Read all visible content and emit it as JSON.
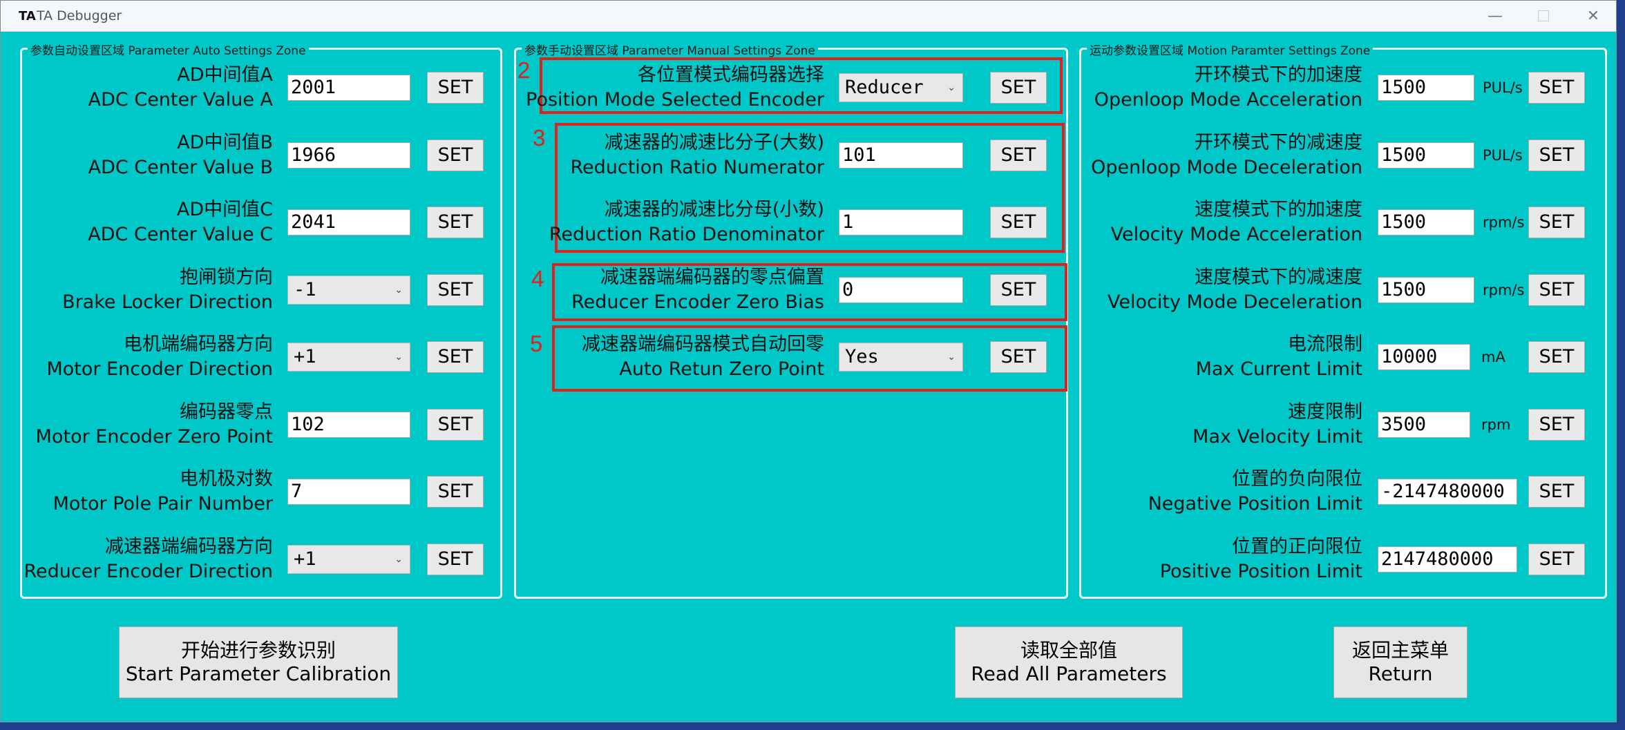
{
  "window": {
    "logo": "TA",
    "title": "TA Debugger",
    "min": "—",
    "close": "✕"
  },
  "zones": {
    "auto": {
      "title": "参数自动设置区域 Parameter Auto Settings Zone",
      "rows": [
        {
          "zh": "AD中间值A",
          "en": "ADC Center Value A",
          "kind": "input",
          "value": "2001",
          "set": "SET"
        },
        {
          "zh": "AD中间值B",
          "en": "ADC Center Value B",
          "kind": "input",
          "value": "1966",
          "set": "SET"
        },
        {
          "zh": "AD中间值C",
          "en": "ADC Center Value C",
          "kind": "input",
          "value": "2041",
          "set": "SET"
        },
        {
          "zh": "抱闸锁方向",
          "en": "Brake Locker Direction",
          "kind": "select",
          "value": "-1",
          "set": "SET"
        },
        {
          "zh": "电机端编码器方向",
          "en": "Motor Encoder Direction",
          "kind": "select",
          "value": "+1",
          "set": "SET"
        },
        {
          "zh": "编码器零点",
          "en": "Motor Encoder Zero Point",
          "kind": "input",
          "value": "102",
          "set": "SET"
        },
        {
          "zh": "电机极对数",
          "en": "Motor Pole Pair Number",
          "kind": "input",
          "value": "7",
          "set": "SET"
        },
        {
          "zh": "减速器端编码器方向",
          "en": "Reducer Encoder Direction",
          "kind": "select",
          "value": "+1",
          "set": "SET"
        }
      ]
    },
    "manual": {
      "title": "参数手动设置区域 Parameter Manual Settings Zone",
      "rows": [
        {
          "zh": "各位置模式编码器选择",
          "en": "Position Mode Selected Encoder",
          "kind": "select",
          "value": "Reducer",
          "set": "SET"
        },
        {
          "zh": "减速器的减速比分子(大数)",
          "en": "Reduction Ratio Numerator",
          "kind": "input",
          "value": "101",
          "set": "SET"
        },
        {
          "zh": "减速器的减速比分母(小数)",
          "en": "Reduction Ratio Denominator",
          "kind": "input",
          "value": "1",
          "set": "SET"
        },
        {
          "zh": "减速器端编码器的零点偏置",
          "en": "Reducer Encoder Zero Bias",
          "kind": "input",
          "value": "0",
          "set": "SET"
        },
        {
          "zh": "减速器端编码器模式自动回零",
          "en": "Auto Retun Zero Point",
          "kind": "select",
          "value": "Yes",
          "set": "SET"
        }
      ],
      "annotations": [
        "2",
        "3",
        "4",
        "5"
      ]
    },
    "motion": {
      "title": "运动参数设置区域 Motion Paramter Settings Zone",
      "rows": [
        {
          "zh": "开环模式下的加速度",
          "en": "Openloop Mode Acceleration",
          "value": "1500",
          "unit": "PUL/s",
          "set": "SET"
        },
        {
          "zh": "开环模式下的减速度",
          "en": "Openloop Mode Deceleration",
          "value": "1500",
          "unit": "PUL/s",
          "set": "SET"
        },
        {
          "zh": "速度模式下的加速度",
          "en": "Velocity Mode Acceleration",
          "value": "1500",
          "unit": "rpm/s",
          "set": "SET"
        },
        {
          "zh": "速度模式下的减速度",
          "en": "Velocity Mode Deceleration",
          "value": "1500",
          "unit": "rpm/s",
          "set": "SET"
        },
        {
          "zh": "电流限制",
          "en": "Max Current Limit",
          "value": "10000",
          "unit": "mA",
          "set": "SET"
        },
        {
          "zh": "速度限制",
          "en": "Max Velocity Limit",
          "value": "3500",
          "unit": "rpm",
          "set": "SET"
        },
        {
          "zh": "位置的负向限位",
          "en": "Negative Position Limit",
          "value": "-2147480000",
          "unit": "",
          "set": "SET"
        },
        {
          "zh": "位置的正向限位",
          "en": "Positive Position Limit",
          "value": "2147480000",
          "unit": "",
          "set": "SET"
        }
      ]
    }
  },
  "buttons": {
    "calibrate": {
      "zh": "开始进行参数识别",
      "en": "Start Parameter Calibration"
    },
    "read_all": {
      "zh": "读取全部值",
      "en": "Read All Parameters"
    },
    "return": {
      "zh": "返回主菜单",
      "en": "Return"
    }
  },
  "colors": {
    "background": "#00c8c8",
    "annotation": "#e0201a",
    "zone_border": "#e9ffff"
  }
}
